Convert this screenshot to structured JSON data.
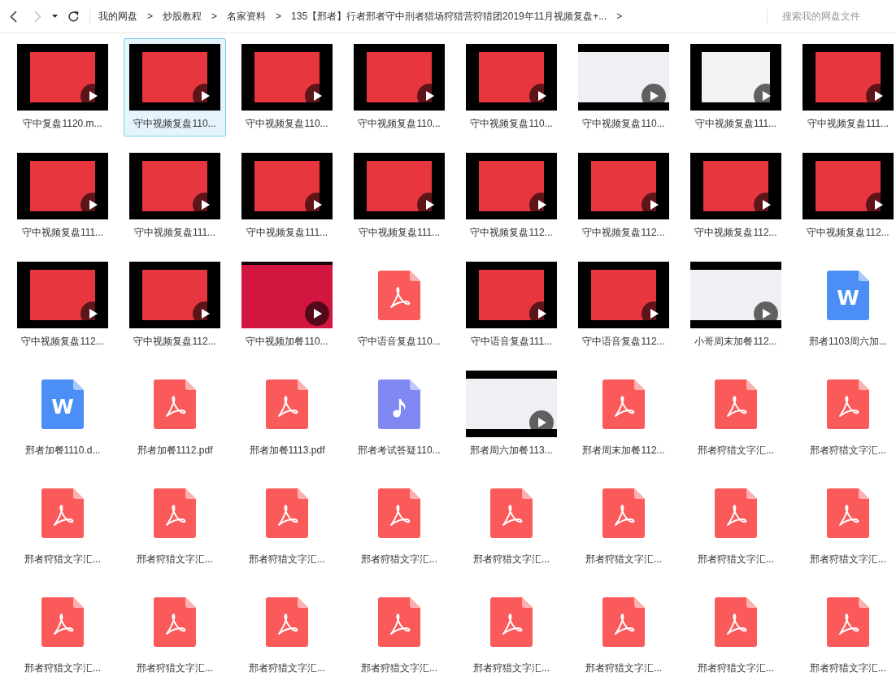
{
  "toolbar": {
    "nav_buttons": [
      {
        "kind": "back",
        "disabled": false
      },
      {
        "kind": "forward",
        "disabled": true
      },
      {
        "kind": "history",
        "disabled": false
      },
      {
        "kind": "refresh",
        "disabled": false
      }
    ],
    "breadcrumb": [
      {
        "label": "我的网盘",
        "separator": ">"
      },
      {
        "label": "炒股教程",
        "separator": ">"
      },
      {
        "label": "名家资料",
        "separator": ">"
      },
      {
        "label": "135【邢者】行者邢者守中刑者猎场狩猎营狩猎团2019年11月视频复盘+...",
        "separator": ">"
      }
    ],
    "search": {
      "placeholder": "搜索我的网盘文件"
    }
  },
  "files": [
    {
      "name": "守中复盘1120.m...",
      "kind": "slide",
      "selected": false
    },
    {
      "name": "守中视频复盘110...",
      "kind": "slide",
      "selected": true
    },
    {
      "name": "守中视频复盘110...",
      "kind": "slide",
      "selected": false
    },
    {
      "name": "守中视频复盘110...",
      "kind": "slide",
      "selected": false
    },
    {
      "name": "守中视频复盘110...",
      "kind": "slide",
      "selected": false
    },
    {
      "name": "守中视频复盘110...",
      "kind": "screen",
      "selected": false
    },
    {
      "name": "守中视频复盘111...",
      "kind": "page",
      "selected": false
    },
    {
      "name": "守中视频复盘111...",
      "kind": "slide",
      "selected": false
    },
    {
      "name": "守中视频复盘111...",
      "kind": "slide",
      "selected": false
    },
    {
      "name": "守中视频复盘111...",
      "kind": "slide",
      "selected": false
    },
    {
      "name": "守中视频复盘111...",
      "kind": "slide",
      "selected": false
    },
    {
      "name": "守中视频复盘111...",
      "kind": "slide",
      "selected": false
    },
    {
      "name": "守中视频复盘112...",
      "kind": "slide",
      "selected": false
    },
    {
      "name": "守中视频复盘112...",
      "kind": "slide",
      "selected": false
    },
    {
      "name": "守中视频复盘112...",
      "kind": "slide",
      "selected": false
    },
    {
      "name": "守中视频复盘112...",
      "kind": "slide",
      "selected": false
    },
    {
      "name": "守中视频复盘112...",
      "kind": "slide",
      "selected": false
    },
    {
      "name": "守中视频复盘112...",
      "kind": "slide",
      "selected": false
    },
    {
      "name": "守中视频加餐110...",
      "kind": "poster",
      "selected": false
    },
    {
      "name": "守中语音复盘110...",
      "kind": "pdf",
      "selected": false
    },
    {
      "name": "守中语音复盘111...",
      "kind": "slide",
      "selected": false
    },
    {
      "name": "守中语音复盘112...",
      "kind": "slide",
      "selected": false
    },
    {
      "name": "小哥周末加餐112...",
      "kind": "screen",
      "selected": false
    },
    {
      "name": "邢者1103周六加...",
      "kind": "word",
      "icon_text": "W",
      "selected": false
    },
    {
      "name": "邢者加餐1110.d...",
      "kind": "word",
      "icon_text": "W",
      "selected": false
    },
    {
      "name": "邢者加餐1112.pdf",
      "kind": "pdf",
      "selected": false
    },
    {
      "name": "邢者加餐1113.pdf",
      "kind": "pdf",
      "selected": false
    },
    {
      "name": "邢者考试答疑110...",
      "kind": "audio",
      "selected": false
    },
    {
      "name": "邢者周六加餐113...",
      "kind": "screen",
      "selected": false
    },
    {
      "name": "邢者周末加餐112...",
      "kind": "pdf",
      "selected": false
    },
    {
      "name": "邢者狩猎文字汇...",
      "kind": "pdf",
      "selected": false
    },
    {
      "name": "邢者狩猎文字汇...",
      "kind": "pdf",
      "selected": false
    },
    {
      "name": "邢者狩猎文字汇...",
      "kind": "pdf",
      "selected": false
    },
    {
      "name": "邢者狩猎文字汇...",
      "kind": "pdf",
      "selected": false
    },
    {
      "name": "邢者狩猎文字汇...",
      "kind": "pdf",
      "selected": false
    },
    {
      "name": "邢者狩猎文字汇...",
      "kind": "pdf",
      "selected": false
    },
    {
      "name": "邢者狩猎文字汇...",
      "kind": "pdf",
      "selected": false
    },
    {
      "name": "邢者狩猎文字汇...",
      "kind": "pdf",
      "selected": false
    },
    {
      "name": "邢者狩猎文字汇...",
      "kind": "pdf",
      "selected": false
    },
    {
      "name": "邢者狩猎文字汇...",
      "kind": "pdf",
      "selected": false
    },
    {
      "name": "邢者狩猎文字汇...",
      "kind": "pdf",
      "selected": false
    },
    {
      "name": "邢者狩猎文字汇...",
      "kind": "pdf",
      "selected": false
    },
    {
      "name": "邢者狩猎文字汇...",
      "kind": "pdf",
      "selected": false
    },
    {
      "name": "邢者狩猎文字汇...",
      "kind": "pdf",
      "selected": false
    },
    {
      "name": "邢者狩猎文字汇...",
      "kind": "pdf",
      "selected": false
    },
    {
      "name": "邢者狩猎文字汇...",
      "kind": "pdf",
      "selected": false
    },
    {
      "name": "邢者狩猎文字汇...",
      "kind": "pdf",
      "selected": false
    },
    {
      "name": "邢者狩猎文字汇...",
      "kind": "pdf",
      "selected": false
    }
  ]
}
